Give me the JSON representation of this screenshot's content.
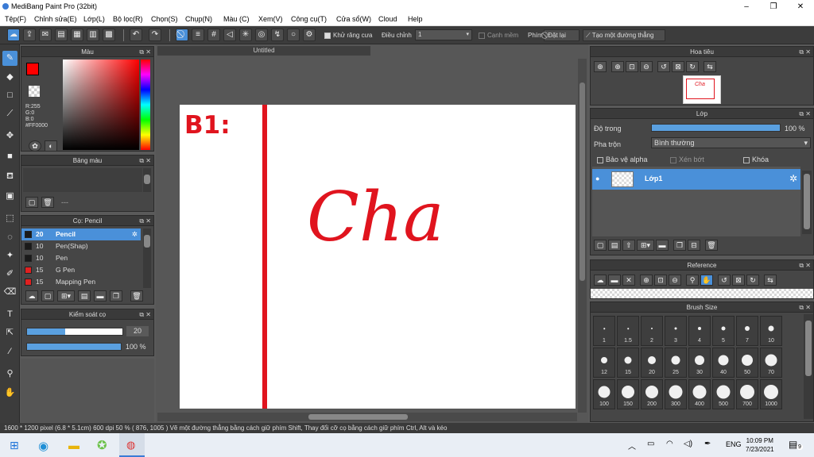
{
  "window": {
    "title": "MediBang Paint Pro (32bit)",
    "minimize": "–",
    "maximize": "❐",
    "close": "✕"
  },
  "menu": [
    "Tệp(F)",
    "Chỉnh sửa(E)",
    "Lớp(L)",
    "Bộ lọc(R)",
    "Chọn(S)",
    "Chụp(N)",
    "Màu (C)",
    "Xem(V)",
    "Công cụ(T)",
    "Cửa sổ(W)",
    "Cloud",
    "Help"
  ],
  "toolbar": {
    "antialias_label": "Khử răng cưa",
    "correction_label": "Điều chỉnh",
    "correction_value": "1",
    "edge_label": "Cạnh mềm",
    "pen_label": "Phím",
    "reset_label": "Đặt lại",
    "straight_line_label": "Tạo một đường thẳng"
  },
  "color_panel": {
    "title": "Màu",
    "r": "R:255",
    "g": "G:0",
    "b": "B:0",
    "hex": "#FF0000",
    "primary_color": "#ff0000"
  },
  "palette_panel": {
    "title": "Bảng màu",
    "empty": "---"
  },
  "brush_panel": {
    "title": "Cọ: Pencil",
    "items": [
      {
        "size": "20",
        "name": "Pencil",
        "color": "#1a1a1a"
      },
      {
        "size": "10",
        "name": "Pen(Shap)",
        "color": "#1a1a1a"
      },
      {
        "size": "10",
        "name": "Pen",
        "color": "#1a1a1a"
      },
      {
        "size": "15",
        "name": "G Pen",
        "color": "#e02020"
      },
      {
        "size": "15",
        "name": "Mapping Pen",
        "color": "#e02020"
      }
    ]
  },
  "brush_control": {
    "title": "Kiểm soát cọ",
    "size_value": "20",
    "size_fraction": 0.4,
    "opacity_value": "100 %",
    "opacity_fraction": 1.0
  },
  "document": {
    "tab": "Untitled",
    "heading": "B1:",
    "word": "Cha"
  },
  "navigator": {
    "title": "Hoa tiêu",
    "thumb_text": "Cha"
  },
  "layer_panel": {
    "title": "Lớp",
    "opacity_label": "Độ trong",
    "opacity_value": "100 %",
    "opacity_fraction": 1.0,
    "blend_label": "Pha trộn",
    "blend_value": "Bình thường",
    "protect_alpha": "Bảo vệ alpha",
    "clip": "Xén bớt",
    "lock": "Khóa",
    "layer_name": "Lớp1"
  },
  "reference_panel": {
    "title": "Reference"
  },
  "brushsize_panel": {
    "title": "Brush Size",
    "sizes": [
      "1",
      "1.5",
      "2",
      "3",
      "4",
      "5",
      "7",
      "10",
      "12",
      "15",
      "20",
      "25",
      "30",
      "40",
      "50",
      "70",
      "100",
      "150",
      "200",
      "300",
      "400",
      "500",
      "700",
      "1000"
    ]
  },
  "status": {
    "text": "1600 * 1200 pixel   (6.8 * 5.1cm)   600 dpi   50 %   ( 876, 1005 )   Vẽ một đường thẳng bằng cách giữ phím Shift, Thay đổi cỡ cọ bằng cách giữ phím Ctrl, Alt và kéo"
  },
  "taskbar": {
    "lang": "ENG",
    "time": "10:09 PM",
    "date": "7/23/2021",
    "notif": "9"
  }
}
